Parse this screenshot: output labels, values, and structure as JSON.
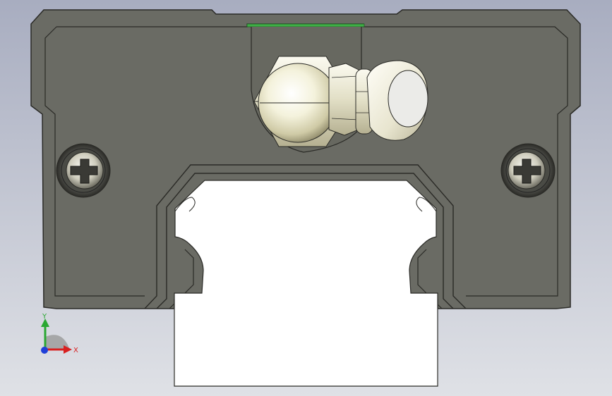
{
  "triad": {
    "x_label": "X",
    "y_label": "Y"
  },
  "colors": {
    "background_top": "#a8adc0",
    "background_bottom": "#dfe1e6",
    "block_body": "#6a6b64",
    "block_outline": "#2a2a26",
    "rail": "#ffffff",
    "seal_strip": "#3fb046",
    "axis_x": "#d82020",
    "axis_y": "#2aa832",
    "axis_z": "#1f3fd8"
  },
  "icons": {
    "screw_left": "cross-head-screw-icon",
    "screw_right": "cross-head-screw-icon",
    "grease_nipple": "grease-nipple-icon",
    "triad": "coordinate-triad-icon"
  }
}
